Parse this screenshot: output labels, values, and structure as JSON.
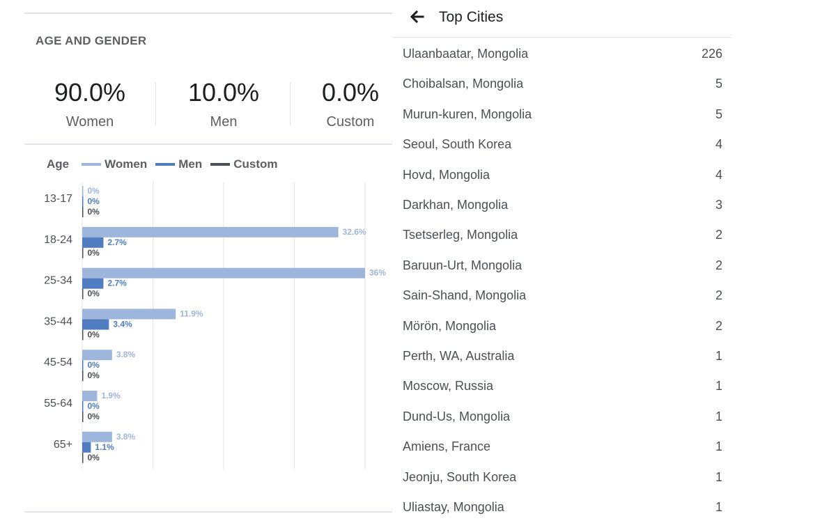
{
  "age_gender": {
    "title": "AGE AND GENDER",
    "summary": [
      {
        "value": "90.0%",
        "label": "Women"
      },
      {
        "value": "10.0%",
        "label": "Men"
      },
      {
        "value": "0.0%",
        "label": "Custom"
      }
    ],
    "legend_title": "Age"
  },
  "colors": {
    "women": "#9fb6dc",
    "men": "#4f7dc0",
    "custom": "#4b4f56"
  },
  "chart_data": {
    "type": "bar",
    "orientation": "horizontal",
    "categories": [
      "13-17",
      "18-24",
      "25-34",
      "35-44",
      "45-54",
      "55-64",
      "65+"
    ],
    "series": [
      {
        "name": "Women",
        "values": [
          0,
          32.6,
          36,
          11.9,
          3.8,
          1.9,
          3.8
        ],
        "labels": [
          "0%",
          "32.6%",
          "36%",
          "11.9%",
          "3.8%",
          "1.9%",
          "3.8%"
        ]
      },
      {
        "name": "Men",
        "values": [
          0,
          2.7,
          2.7,
          3.4,
          0,
          0,
          1.1
        ],
        "labels": [
          "0%",
          "2.7%",
          "2.7%",
          "3.4%",
          "0%",
          "0%",
          "1.1%"
        ]
      },
      {
        "name": "Custom",
        "values": [
          0,
          0,
          0,
          0,
          0,
          0,
          0
        ],
        "labels": [
          "0%",
          "0%",
          "0%",
          "0%",
          "0%",
          "0%",
          "0%"
        ]
      }
    ],
    "xlim": [
      0,
      36
    ],
    "grid": true,
    "legend": "top"
  },
  "top_cities": {
    "title": "Top Cities",
    "back_icon": "arrow-left-icon",
    "cities": [
      {
        "name": "Ulaanbaatar, Mongolia",
        "count": "226"
      },
      {
        "name": "Choibalsan, Mongolia",
        "count": "5"
      },
      {
        "name": "Murun-kuren, Mongolia",
        "count": "5"
      },
      {
        "name": "Seoul, South Korea",
        "count": "4"
      },
      {
        "name": "Hovd, Mongolia",
        "count": "4"
      },
      {
        "name": "Darkhan, Mongolia",
        "count": "3"
      },
      {
        "name": "Tsetserleg, Mongolia",
        "count": "2"
      },
      {
        "name": "Baruun-Urt, Mongolia",
        "count": "2"
      },
      {
        "name": "Sain-Shand, Mongolia",
        "count": "2"
      },
      {
        "name": "Mörön, Mongolia",
        "count": "2"
      },
      {
        "name": "Perth, WA, Australia",
        "count": "1"
      },
      {
        "name": "Moscow, Russia",
        "count": "1"
      },
      {
        "name": "Dund-Us, Mongolia",
        "count": "1"
      },
      {
        "name": "Amiens, France",
        "count": "1"
      },
      {
        "name": "Jeonju, South Korea",
        "count": "1"
      },
      {
        "name": "Uliastay, Mongolia",
        "count": "1"
      }
    ]
  }
}
